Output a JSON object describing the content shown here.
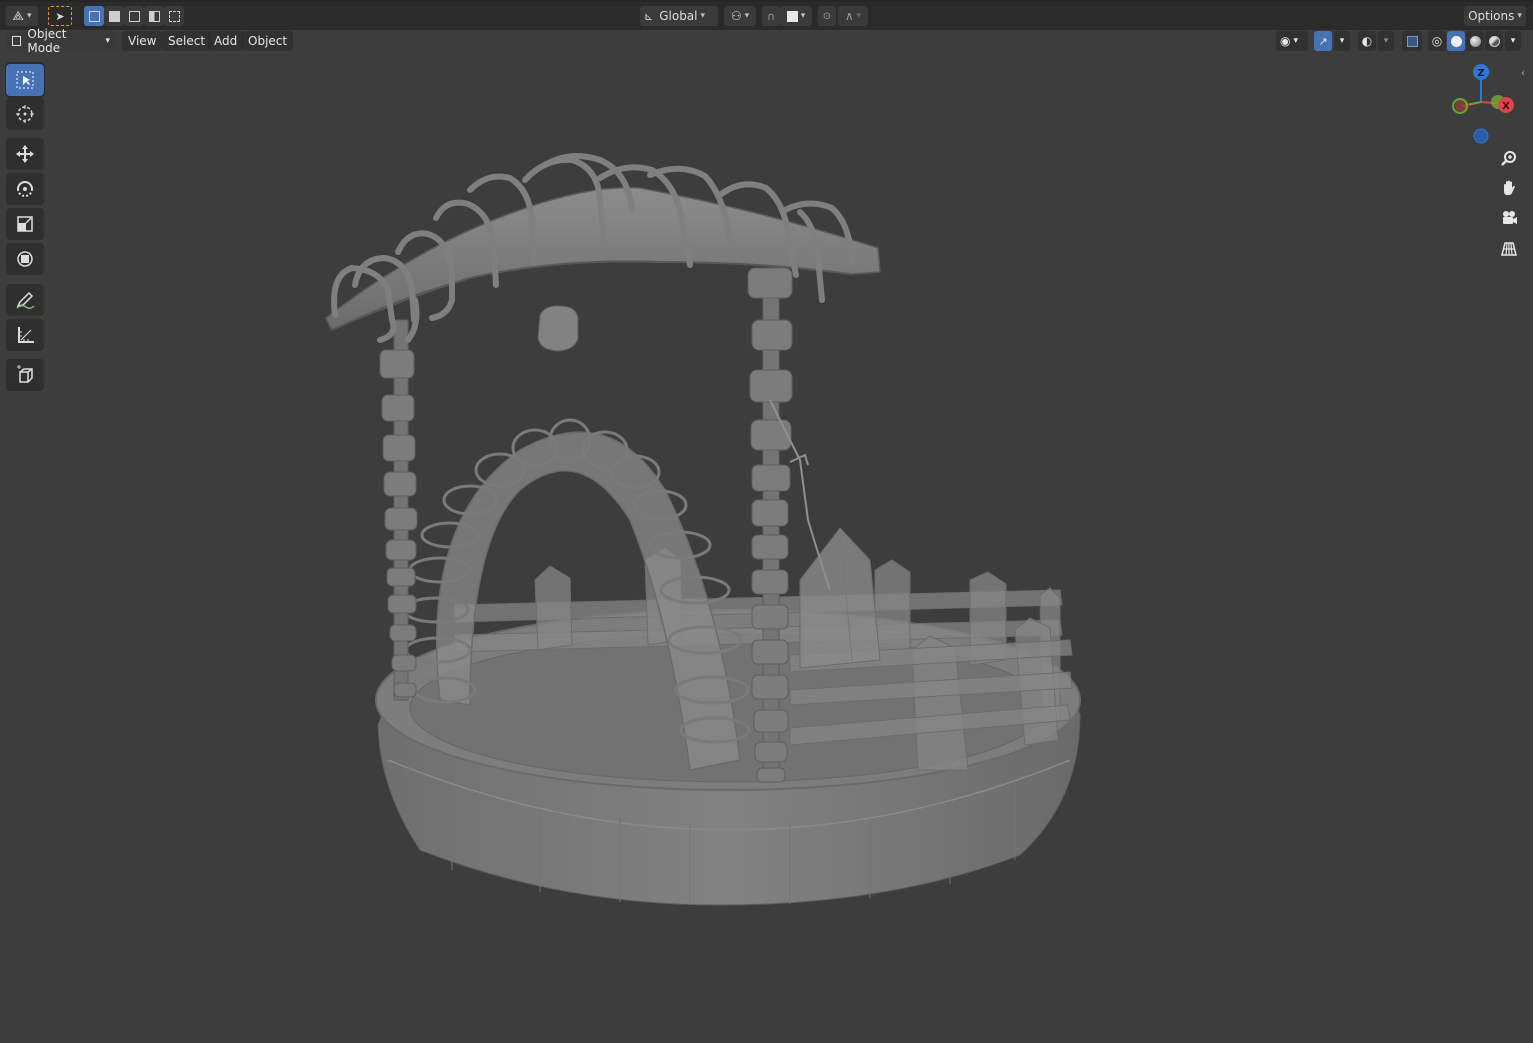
{
  "header": {
    "transform_orientation": "Global",
    "options_label": "Options"
  },
  "menu": {
    "mode": "Object Mode",
    "items": [
      "View",
      "Select",
      "Add",
      "Object"
    ]
  },
  "gizmo": {
    "axes": {
      "z": "Z",
      "x": "X"
    },
    "colors": {
      "x": "#e0424f",
      "y": "#6ea530",
      "z": "#2d77d8"
    }
  },
  "theme": {
    "accent": "#4772b3",
    "viewport_bg": "#3d3d3d",
    "header_bg": "#2b2b2b"
  },
  "tools": [
    "select-box",
    "cursor",
    "move",
    "rotate",
    "scale",
    "transform",
    "annotate",
    "measure",
    "add-cube"
  ],
  "nav_controls": [
    "zoom",
    "pan",
    "camera",
    "perspective-toggle"
  ]
}
